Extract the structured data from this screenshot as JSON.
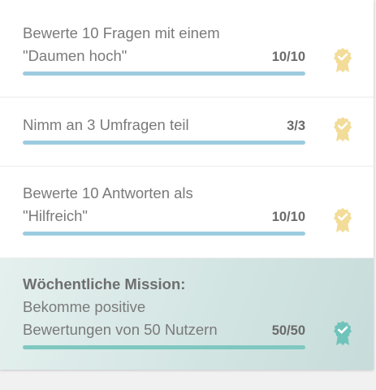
{
  "missions": [
    {
      "title_line1": "Bewerte 10 Fragen mit einem",
      "title_line2": "\"Daumen hoch\"",
      "count": "10/10",
      "progress": 1.0,
      "badge_icon": "award-ribbon-check-icon",
      "badge_color": "#f2dc98"
    },
    {
      "title_line1": "Nimm an 3 Umfragen teil",
      "count": "3/3",
      "progress": 1.0,
      "badge_icon": "award-ribbon-check-icon",
      "badge_color": "#f2dc98"
    },
    {
      "title_line1": "Bewerte 10 Antworten als",
      "title_line2": "\"Hilfreich\"",
      "count": "10/10",
      "progress": 1.0,
      "badge_icon": "award-ribbon-check-icon",
      "badge_color": "#f2dc98"
    }
  ],
  "weekly_mission": {
    "heading": "Wöchentliche Mission:",
    "title_line1": "Bekomme positive",
    "title_line2": "Bewertungen von 50 Nutzern",
    "count": "50/50",
    "progress": 1.0,
    "badge_icon": "award-ribbon-check-icon",
    "badge_color": "#6fc3bb"
  },
  "colors": {
    "progress_bar": "#9ccbe0",
    "weekly_progress_bar": "#7ec8c0",
    "weekly_background": "#d3e5e3"
  }
}
